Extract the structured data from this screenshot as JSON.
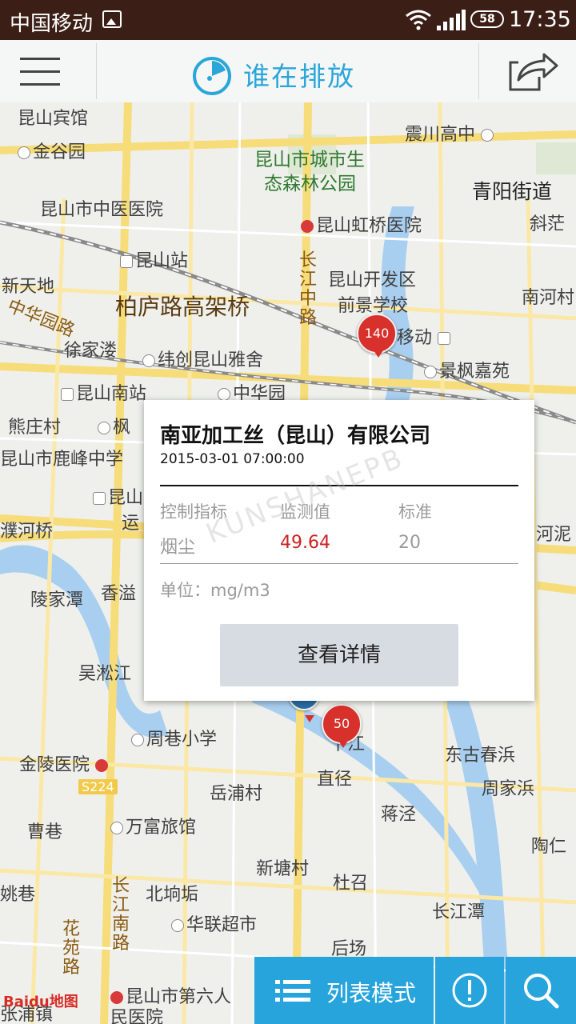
{
  "status_bar": {
    "carrier": "中国移动",
    "battery": "58",
    "time": "17:35"
  },
  "header": {
    "title": "谁在排放"
  },
  "map": {
    "labels": {
      "l1": "昆山宾馆",
      "l2": "金谷园",
      "l3": "昆山市中医医院",
      "l4": "昆山站",
      "l5": "新天地",
      "l6": "中华园路",
      "l7": "柏庐路高架桥",
      "l8": "徐家溇",
      "l9": "纬创昆山雅舍",
      "l10": "昆山南站",
      "l11": "中华园",
      "l12": "熊庄村",
      "l13": "枫",
      "l14": "昆山市鹿峰中学",
      "l15": "昆山",
      "l16": "运",
      "l17": "濮河桥",
      "l18": "陵家潭",
      "l19": "香溢",
      "l20": "吴淞江",
      "l21": "周巷小学",
      "l22": "金陵医院",
      "l23": "S224",
      "l24": "岳浦村",
      "l25": "曹巷",
      "l26": "万富旅馆",
      "l27": "新塘村",
      "l28": "北垧垢",
      "l29": "华联超市",
      "l30": "花苑路",
      "l31": "长江南路",
      "l32": "昆山市第六人民医院",
      "l33": "张浦镇",
      "l34": "震川高中",
      "l35": "昆山市城市生",
      "l36": "态森林公园",
      "l37": "青阳街道",
      "l38": "斜茫",
      "l39": "昆山虹桥医院",
      "l40": "长江中路",
      "l41": "昆山开发区",
      "l42": "前景学校",
      "l43": "移动",
      "l44": "南河村",
      "l45": "景枫嘉苑",
      "l46": "河泥",
      "l47": "东古春浜",
      "l48": "周家浜",
      "l49": "直径",
      "l50": "蒋泾",
      "l51": "陶仁",
      "l52": "杜召",
      "l53": "长江潭",
      "l54": "后场",
      "l55": "姚巷",
      "l56": "下江"
    },
    "markers": {
      "m1": "140",
      "m2": "50"
    }
  },
  "popup": {
    "company": "南亚加工丝（昆山）有限公司",
    "datetime": "2015-03-01 07:00:00",
    "col_indicator": "控制指标",
    "col_value": "监测值",
    "col_standard": "标准",
    "indicator": "烟尘",
    "value": "49.64",
    "standard": "20",
    "unit": "单位：mg/m3",
    "details_button": "查看详情",
    "watermark": "KUNSHANEPB"
  },
  "bottom_bar": {
    "list_mode": "列表模式"
  },
  "attribution": "Baidu地图",
  "colors": {
    "accent": "#27a4dc",
    "marker": "#d8302a",
    "value": "#cc2222"
  }
}
